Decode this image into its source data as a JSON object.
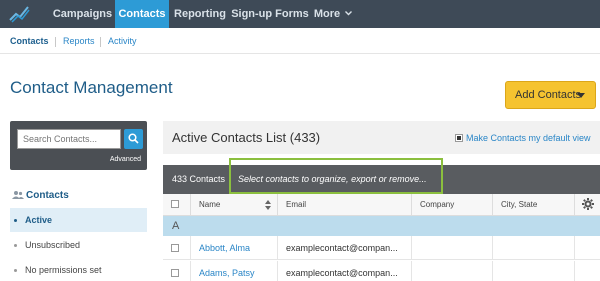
{
  "topnav": {
    "items": [
      {
        "label": "Campaigns"
      },
      {
        "label": "Contacts"
      },
      {
        "label": "Reporting"
      },
      {
        "label": "Sign-up Forms"
      },
      {
        "label": "More"
      }
    ],
    "active": "Contacts"
  },
  "subnav": {
    "items": [
      {
        "label": "Contacts"
      },
      {
        "label": "Reports"
      },
      {
        "label": "Activity"
      }
    ]
  },
  "page": {
    "title": "Contact Management",
    "add_button": "Add Contacts"
  },
  "sidebar": {
    "search_placeholder": "Search Contacts...",
    "advanced": "Advanced",
    "heading": "Contacts",
    "items": [
      {
        "label": "Active"
      },
      {
        "label": "Unsubscribed"
      },
      {
        "label": "No permissions set"
      }
    ]
  },
  "list": {
    "title": "Active Contacts List (433)",
    "default_view": "Make Contacts my default view",
    "count": "433 Contacts",
    "select_hint": "Select contacts to organize, export or remove...",
    "columns": [
      "Name",
      "Email",
      "Company",
      "City, State"
    ],
    "group_letter": "A",
    "rows": [
      {
        "name": "Abbott, Alma",
        "email": "examplecontact@compan...",
        "company": "",
        "city": ""
      },
      {
        "name": "Adams, Patsy",
        "email": "examplecontact@compan...",
        "company": "",
        "city": ""
      }
    ]
  },
  "colors": {
    "nav_bg": "#3e4a57",
    "nav_active": "#2d9bd6",
    "accent_yellow": "#f5c330",
    "highlight": "#8bbf3e"
  }
}
